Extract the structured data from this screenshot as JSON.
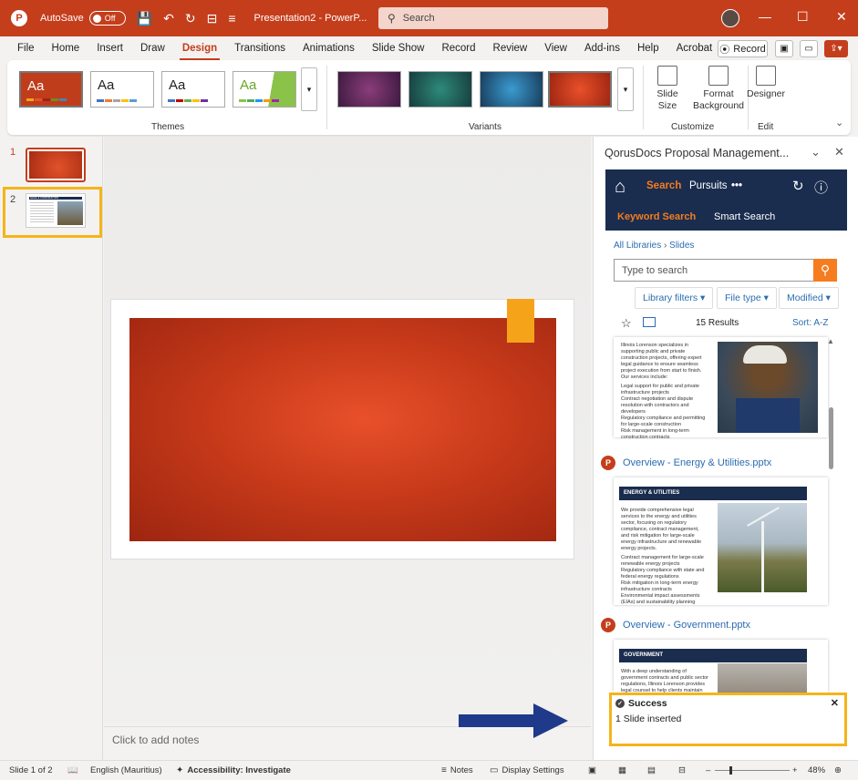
{
  "titlebar": {
    "logo": "P",
    "autosave_label": "AutoSave",
    "autosave_state": "Off",
    "doc_title": "Presentation2 - PowerP...",
    "search_placeholder": "Search",
    "minimize": "—",
    "maximize": "☐",
    "close": "✕"
  },
  "menu": {
    "tabs": [
      "File",
      "Home",
      "Insert",
      "Draw",
      "Design",
      "Transitions",
      "Animations",
      "Slide Show",
      "Record",
      "Review",
      "View",
      "Add-ins",
      "Help",
      "Acrobat"
    ],
    "active": "Design",
    "record_label": "Record"
  },
  "ribbon": {
    "themes_label": "Themes",
    "variants_label": "Variants",
    "customize_label": "Customize",
    "edit_label": "Edit",
    "theme_sample": "Aa",
    "slide_size_label": "Slide Size",
    "format_bg_label": "Format Background",
    "designer_label": "Designer"
  },
  "slides": {
    "numbers": [
      "1",
      "2"
    ],
    "thumb2_title": "LEGAL & CONSTRUCTION"
  },
  "notes": {
    "placeholder": "Click to add notes"
  },
  "pane": {
    "title": "QorusDocs Proposal Management...",
    "nav_search": "Search",
    "nav_pursuits": "Pursuits",
    "nav_more": "•••",
    "tab_keyword": "Keyword Search",
    "tab_smart": "Smart Search",
    "breadcrumb_root": "All Libraries",
    "breadcrumb_sep": "›",
    "breadcrumb_current": "Slides",
    "search_placeholder": "Type to search",
    "filter_library": "Library filters ▾",
    "filter_type": "File type ▾",
    "filter_modified": "Modified ▾",
    "results_count": "15 Results",
    "sort_label": "Sort: A-Z",
    "card1_text": "Illinois Lorenson specializes in supporting public and private construction projects, offering expert legal guidance to ensure seamless project execution from start to finish. Our services include:",
    "card1_bullets": [
      "Legal support for public and private infrastructure projects",
      "Contract negotiation and dispute resolution with contractors and developers",
      "Regulatory compliance and permitting for large-scale construction",
      "Risk management in long-term construction contracts"
    ],
    "file2": "Overview - Energy & Utilities.pptx",
    "card2_title": "ENERGY & UTILITIES",
    "card2_text": "We provide comprehensive legal services to the energy and utilities sector, focusing on regulatory compliance, contract management, and risk mitigation for large-scale energy infrastructure and renewable energy projects.",
    "card2_bullets": [
      "Contract management for large-scale renewable energy projects",
      "Regulatory compliance with state and federal energy regulations",
      "Risk mitigation in long-term energy infrastructure contracts",
      "Environmental impact assessments (EIAs) and sustainability planning"
    ],
    "file3": "Overview - Government.pptx",
    "card3_title": "GOVERNMENT",
    "card3_text": "With a deep understanding of government contracts and public sector regulations, Illinois Lorenson provides legal counsel to help clients maintain compliance, manage procurement, and..."
  },
  "toast": {
    "title": "Success",
    "message": "1 Slide inserted",
    "close": "✕"
  },
  "statusbar": {
    "slide_pos": "Slide 1 of 2",
    "language": "English (Mauritius)",
    "accessibility": "Accessibility: Investigate",
    "notes": "Notes",
    "display": "Display Settings",
    "zoom": "48%"
  },
  "colors": {
    "brand": "#c43e1c",
    "highlight": "#f5b41a",
    "arrow": "#1f3a8a",
    "qorus_navy": "#1a2d4f",
    "qorus_orange": "#f57c1f"
  }
}
